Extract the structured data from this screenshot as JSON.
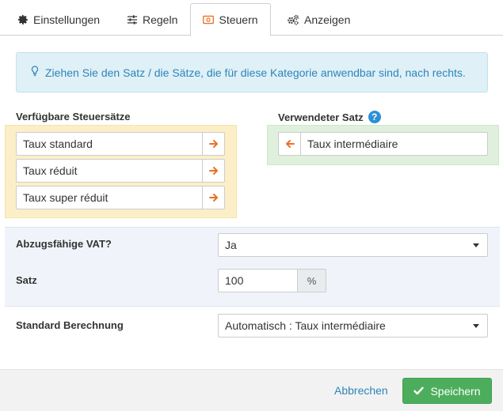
{
  "tabs": [
    {
      "label": "Einstellungen",
      "icon": "gear-icon",
      "active": false
    },
    {
      "label": "Regeln",
      "icon": "sliders-icon",
      "active": false
    },
    {
      "label": "Steuern",
      "icon": "money-icon",
      "active": true
    },
    {
      "label": "Anzeigen",
      "icon": "cogs-icon",
      "active": false
    }
  ],
  "alert": {
    "icon": "lightbulb-icon",
    "text": "Ziehen Sie den Satz / die Sätze, die für diese Kategorie anwendbar sind, nach rechts."
  },
  "available": {
    "title": "Verfügbare Steuersätze",
    "items": [
      "Taux standard",
      "Taux réduit",
      "Taux super réduit"
    ]
  },
  "used": {
    "title": "Verwendeter Satz",
    "help": "?",
    "items": [
      "Taux intermédiaire"
    ]
  },
  "fields": {
    "vat_label": "Abzugsfähige VAT?",
    "vat_value": "Ja",
    "rate_label": "Satz",
    "rate_value": "100",
    "rate_unit": "%",
    "calc_label": "Standard Berechnung",
    "calc_value": "Automatisch : Taux intermédiaire"
  },
  "footer": {
    "cancel_label": "Abbrechen",
    "save_label": "Speichern"
  },
  "colors": {
    "accent_blue": "#2d85b8",
    "arrow_orange": "#e8712a",
    "save_green": "#4cae5c",
    "available_bg": "#fcefc7",
    "used_bg": "#dff0dc",
    "alert_bg": "#dff0f7"
  }
}
